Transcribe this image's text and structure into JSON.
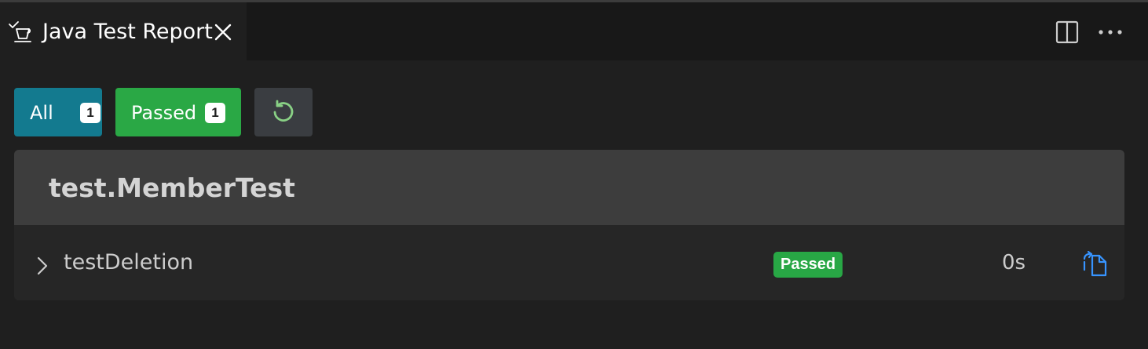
{
  "tab": {
    "title": "Java Test Report",
    "icon": "test-beaker-icon",
    "close_icon": "close-icon"
  },
  "editor_actions": {
    "split_icon": "split-editor-icon",
    "more_icon": "more-actions-icon"
  },
  "filters": {
    "all": {
      "label": "All",
      "count": "1",
      "color": "#137a8f"
    },
    "passed": {
      "label": "Passed",
      "count": "1",
      "color": "#2aa845"
    },
    "rerun": {
      "icon": "rerun-icon",
      "color": "#3a3d41",
      "icon_color": "#89d185"
    }
  },
  "report": {
    "class_name": "test.MemberTest",
    "tests": [
      {
        "name": "testDeletion",
        "status": "Passed",
        "status_color": "#28a745",
        "duration": "0s",
        "expand_icon": "chevron-right-icon",
        "goto_icon": "go-to-file-icon"
      }
    ]
  },
  "colors": {
    "background": "#1f1f1f",
    "tabbar": "#181818",
    "header": "#3d3d3d",
    "row": "#262626",
    "link": "#3794ff"
  }
}
